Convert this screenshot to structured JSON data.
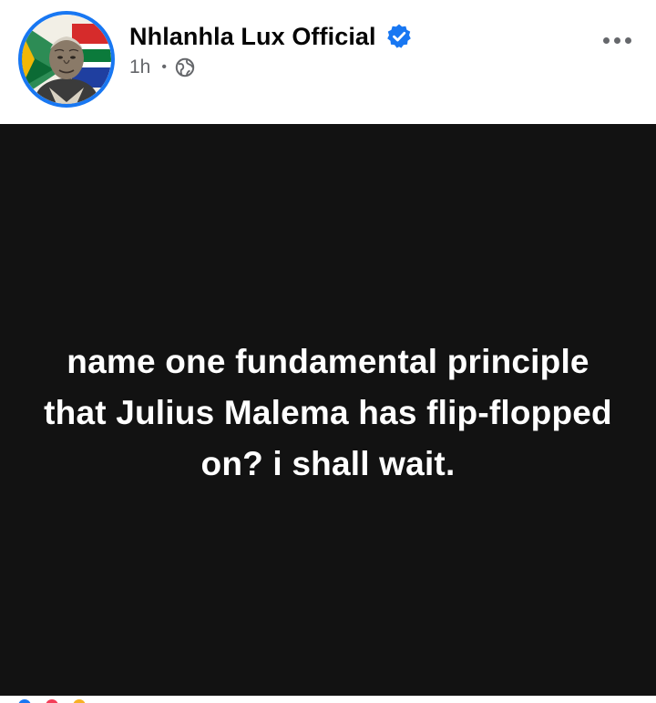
{
  "post": {
    "author": {
      "name": "Nhlanhla Lux Official",
      "verified": true,
      "avatar_icon": "mandela-flag-avatar"
    },
    "meta": {
      "time": "1h",
      "separator": "•",
      "audience_icon": "globe-icon"
    },
    "menu_icon": "more-options-icon",
    "media": {
      "background": "#121212",
      "text": "name one fundamental principle that Julius Malema has flip-flopped on? i shall wait."
    }
  },
  "colors": {
    "accent": "#1877f2",
    "name_text": "#050505",
    "secondary_text": "#65676b",
    "media_bg": "#121212",
    "media_text": "#ffffff"
  }
}
